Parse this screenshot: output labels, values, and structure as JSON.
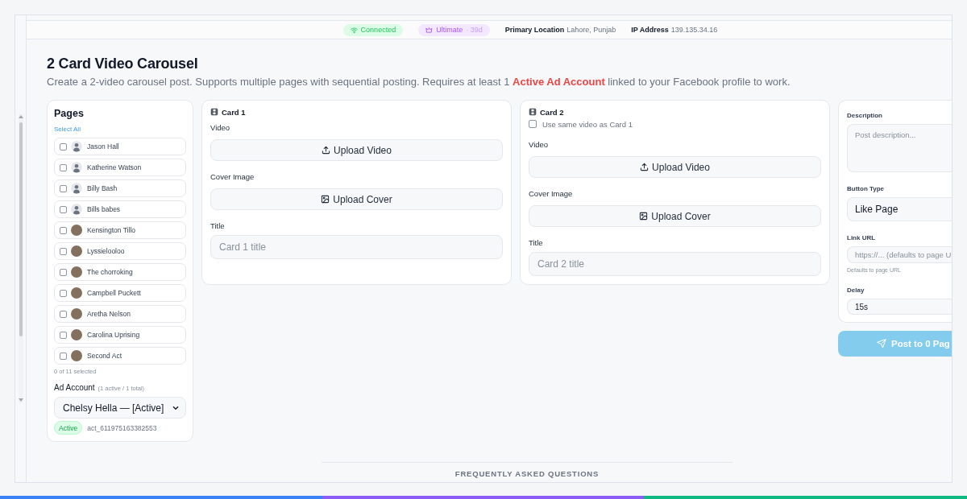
{
  "status_bar": {
    "connection": {
      "label": "Connected"
    },
    "plan": {
      "label": "Ultimate",
      "period": "· 39d"
    },
    "location": {
      "label": "Primary Location",
      "value": "Lahore, Punjab"
    },
    "ip_address": {
      "label": "IP Address",
      "value": "139.135.34.16"
    }
  },
  "header": {
    "title": "2 Card Video Carousel",
    "description": "Create a 2-video carousel post. Supports multiple pages with sequential posting. Requires at least 1 **Active Ad Account** linked to your Facebook profile to work."
  },
  "pages_panel": {
    "title": "Pages",
    "select_all": "Select All",
    "pages": [
      {
        "name": "Jason Hall",
        "kind": "silhouette",
        "checked": false
      },
      {
        "name": "Katherine Watson",
        "kind": "silhouette",
        "checked": false
      },
      {
        "name": "Billy Bash",
        "kind": "silhouette",
        "checked": false
      },
      {
        "name": "Bills babes",
        "kind": "silhouette",
        "checked": false
      },
      {
        "name": "Kensington Tillo",
        "kind": "photo",
        "checked": false
      },
      {
        "name": "Lyssielooloo",
        "kind": "photo",
        "checked": false
      },
      {
        "name": "The chorroking",
        "kind": "photo",
        "checked": false
      },
      {
        "name": "Campbell Puckett",
        "kind": "photo",
        "checked": false
      },
      {
        "name": "Aretha Nelson",
        "kind": "photo",
        "checked": false
      },
      {
        "name": "Carolina Uprising",
        "kind": "photo",
        "checked": false
      },
      {
        "name": "Second Act",
        "kind": "photo",
        "checked": false
      }
    ],
    "selected_count": "0 of 11 selected",
    "ad_account": {
      "label": "Ad Account",
      "summary": "(1 active / 1 total)",
      "value": "Chelsy Hella — [Active]",
      "status": "Active",
      "account_id": "act_611975163382553"
    }
  },
  "cards": [
    {
      "title": "Card 1",
      "video_label": "Video",
      "video_button": "Upload Video",
      "cover_label": "Cover Image",
      "cover_button": "Upload Cover",
      "title_label": "Title",
      "title_placeholder": "Card 1 title"
    },
    {
      "title": "Card 2",
      "same_video_option": {
        "label": "Use same video as Card 1",
        "checked": false
      },
      "video_label": "Video",
      "video_button": "Upload Video",
      "cover_label": "Cover Image",
      "cover_button": "Upload Cover",
      "title_label": "Title",
      "title_placeholder": "Card 2 title"
    }
  ],
  "post_settings": {
    "description_label": "Description",
    "description_placeholder": "Post description...",
    "button_type_label": "Button Type",
    "button_type_value": "Like Page",
    "link_url_label": "Link URL",
    "link_url_placeholder": "https://... (defaults to page U",
    "link_url_hint": "Defaults to page URL",
    "delay_label": "Delay",
    "delay_value": "15s"
  },
  "post_button": {
    "label": "Post to 0 Pag",
    "disabled": true
  },
  "faq": {
    "heading": "FREQUENTLY ASKED QUESTIONS"
  }
}
